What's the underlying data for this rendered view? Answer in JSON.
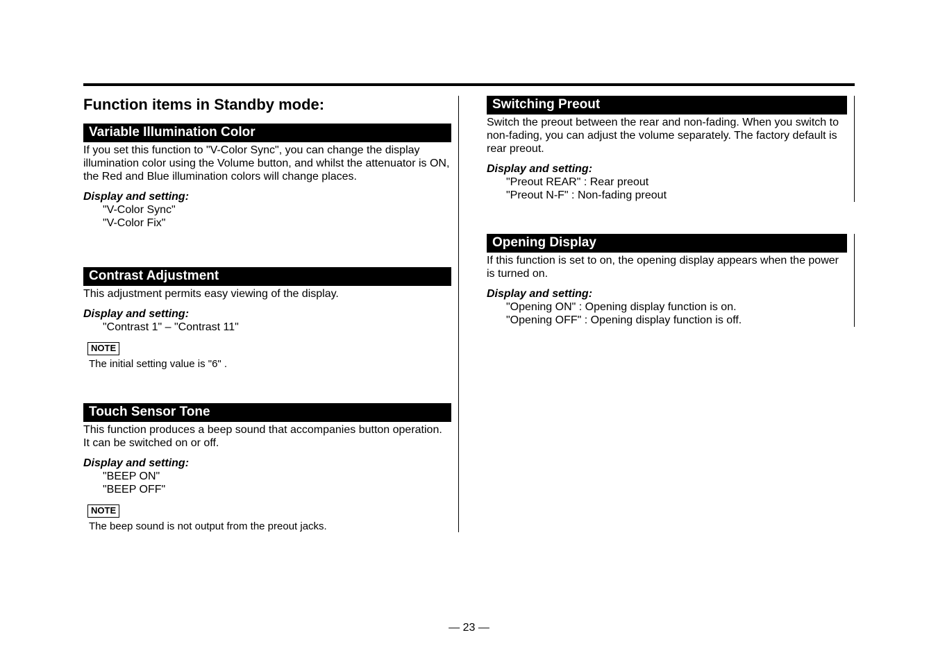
{
  "left": {
    "title": "Function items in Standby mode:",
    "sections": [
      {
        "heading": "Variable Illumination Color",
        "body": "If you set this function to \"V-Color Sync\", you can change the display illumination color using the Volume button, and whilst the attenuator is ON, the Red and Blue illumination colors will change places.",
        "disp_label": "Display and setting:",
        "settings": [
          "\"V-Color Sync\"",
          "\"V-Color Fix\""
        ]
      },
      {
        "heading": "Contrast Adjustment",
        "body": "This adjustment permits easy viewing of the display.",
        "disp_label": "Display and setting:",
        "settings": [
          "\"Contrast 1\" – \"Contrast 11\""
        ],
        "note_label": "NOTE",
        "note_text": "The initial setting value is \"6\" ."
      },
      {
        "heading": "Touch Sensor Tone",
        "body": "This function produces a beep sound that accompanies button operation. It can be switched on or off.",
        "disp_label": "Display and setting:",
        "settings": [
          "\"BEEP ON\"",
          "\"BEEP OFF\""
        ],
        "note_label": "NOTE",
        "note_text": "The beep sound is not output from the preout jacks."
      }
    ]
  },
  "right": {
    "sections": [
      {
        "heading": "Switching Preout",
        "body": "Switch the preout between the rear and non-fading. When you switch to non-fading, you can adjust the volume separately. The factory default is rear preout.",
        "disp_label": "Display and setting:",
        "settings": [
          "\"Preout REAR\" : Rear preout",
          "\"Preout N-F\" : Non-fading preout"
        ]
      },
      {
        "heading": "Opening Display",
        "body": "If this function is set to on, the opening display appears when the power is turned on.",
        "disp_label": "Display and setting:",
        "settings": [
          "\"Opening ON\" : Opening display function is on.",
          "\"Opening OFF\" : Opening display function is off."
        ]
      }
    ]
  },
  "page_number": "— 23 —"
}
